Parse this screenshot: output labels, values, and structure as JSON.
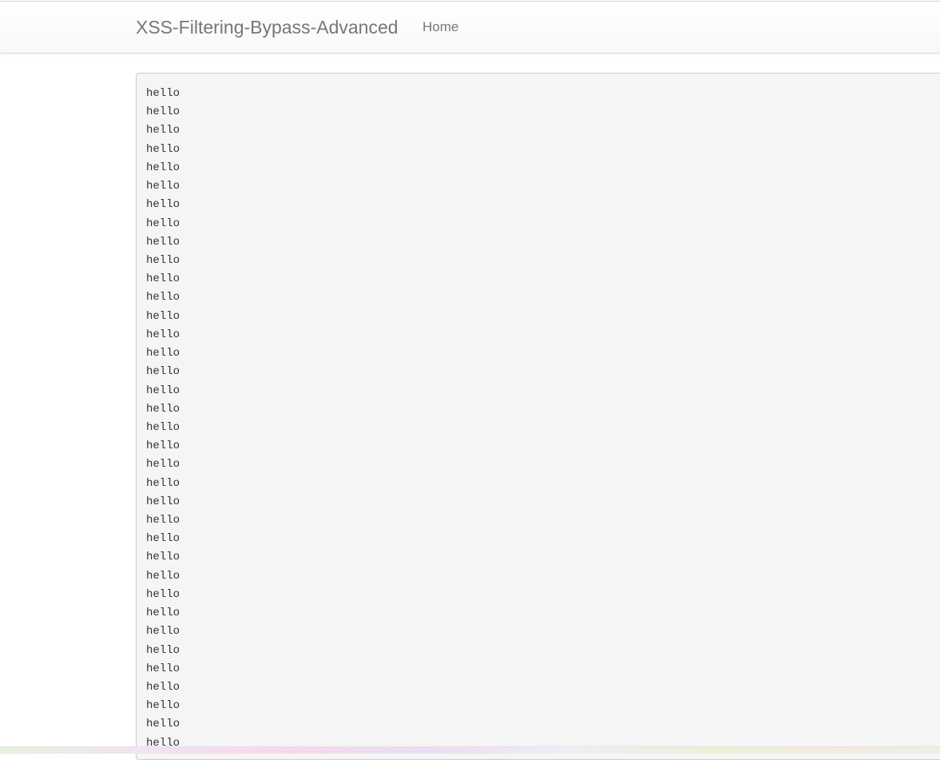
{
  "navbar": {
    "brand": "XSS-Filtering-Bypass-Advanced",
    "links": [
      {
        "label": "Home"
      }
    ]
  },
  "content": {
    "lines": [
      "hello",
      "hello",
      "hello",
      "hello",
      "hello",
      "hello",
      "hello",
      "hello",
      "hello",
      "hello",
      "hello",
      "hello",
      "hello",
      "hello",
      "hello",
      "hello",
      "hello",
      "hello",
      "hello",
      "hello",
      "hello",
      "hello",
      "hello",
      "hello",
      "hello",
      "hello",
      "hello",
      "hello",
      "hello",
      "hello",
      "hello",
      "hello",
      "hello",
      "hello",
      "hello",
      "hello"
    ]
  },
  "colors": {
    "navbar_text": "#777777",
    "pre_background": "#f5f5f5",
    "pre_border": "#cccccc",
    "pre_text": "#333333"
  }
}
